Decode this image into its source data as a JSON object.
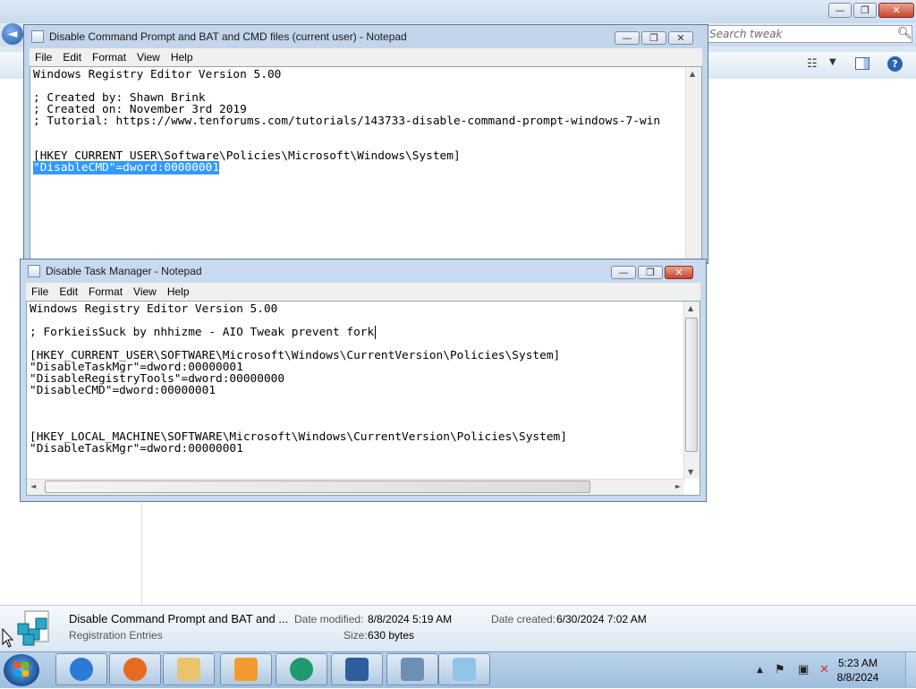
{
  "explorer": {
    "search_placeholder": "Search tweak",
    "back_glyph": "◄",
    "details": {
      "file_name": "Disable Command Prompt and BAT and ...",
      "file_type": "Registration Entries",
      "date_modified_label": "Date modified:",
      "date_modified": "8/8/2024 5:19 AM",
      "date_created_label": "Date created:",
      "date_created": "6/30/2024 7:02 AM",
      "size_label": "Size:",
      "size": "630 bytes"
    }
  },
  "notepad1": {
    "title": "Disable Command Prompt and BAT and CMD files (current user) - Notepad",
    "menu": [
      "File",
      "Edit",
      "Format",
      "View",
      "Help"
    ],
    "lines": [
      "Windows Registry Editor Version 5.00",
      "",
      "; Created by: Shawn Brink",
      "; Created on: November 3rd 2019",
      "; Tutorial: https://www.tenforums.com/tutorials/143733-disable-command-prompt-windows-7-win",
      "",
      "",
      "[HKEY_CURRENT_USER\\Software\\Policies\\Microsoft\\Windows\\System]"
    ],
    "selected_line": "\"DisableCMD\"=dword:00000001"
  },
  "notepad2": {
    "title": "Disable Task Manager - Notepad",
    "menu": [
      "File",
      "Edit",
      "Format",
      "View",
      "Help"
    ],
    "lines_before_caret": [
      "Windows Registry Editor Version 5.00",
      ""
    ],
    "caret_line": "; ForkieisSuck by nhhizme - AIO Tweak prevent fork",
    "lines_after_caret": [
      "",
      "[HKEY_CURRENT_USER\\SOFTWARE\\Microsoft\\Windows\\CurrentVersion\\Policies\\System]",
      "\"DisableTaskMgr\"=dword:00000001",
      "\"DisableRegistryTools\"=dword:00000000",
      "\"DisableCMD\"=dword:00000001",
      "",
      "",
      "",
      "[HKEY_LOCAL_MACHINE\\SOFTWARE\\Microsoft\\Windows\\CurrentVersion\\Policies\\System]",
      "\"DisableTaskMgr\"=dword:00000001"
    ]
  },
  "window_buttons": {
    "minimize": "—",
    "maximize": "❐",
    "close": "✕"
  },
  "taskbar": {
    "items": [
      {
        "name": "internet-explorer",
        "color": "#2b7bd6"
      },
      {
        "name": "firefox",
        "color": "#e66a1f"
      },
      {
        "name": "file-explorer",
        "color": "#e9c46a"
      },
      {
        "name": "media-player",
        "color": "#f29a2e"
      },
      {
        "name": "browser-green",
        "color": "#1e9a6e"
      },
      {
        "name": "virtualbox",
        "color": "#2f5d9b"
      },
      {
        "name": "calculator",
        "color": "#6f8fb5"
      },
      {
        "name": "notepad",
        "color": "#8ec5e8"
      }
    ],
    "time": "5:23 AM",
    "date": "8/8/2024"
  }
}
